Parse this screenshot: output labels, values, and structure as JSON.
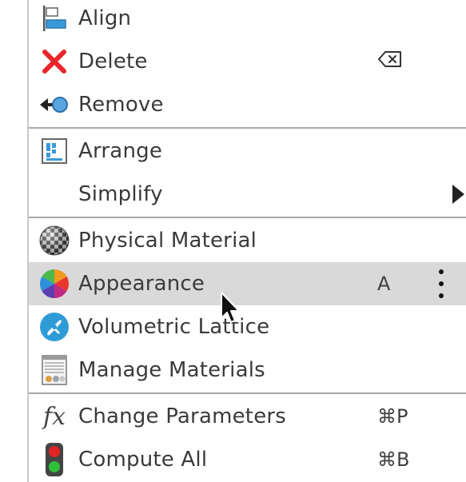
{
  "menu": {
    "items": [
      {
        "label": "Align",
        "icon": "align-icon"
      },
      {
        "label": "Delete",
        "icon": "delete-x-icon",
        "shortcut_icon": "delete-key-icon"
      },
      {
        "label": "Remove",
        "icon": "remove-icon"
      },
      {
        "label": "Arrange",
        "icon": "arrange-icon"
      },
      {
        "label": "Simplify",
        "submenu": true
      },
      {
        "label": "Physical Material",
        "icon": "physical-material-icon"
      },
      {
        "label": "Appearance",
        "icon": "appearance-icon",
        "shortcut": "A",
        "highlighted": true,
        "more": true
      },
      {
        "label": "Volumetric Lattice",
        "icon": "volumetric-lattice-icon"
      },
      {
        "label": "Manage Materials",
        "icon": "manage-materials-icon"
      },
      {
        "label": "Change Parameters",
        "icon": "fx-icon",
        "shortcut": "⌘P"
      },
      {
        "label": "Compute All",
        "icon": "traffic-light-icon",
        "shortcut": "⌘B"
      }
    ]
  },
  "colors": {
    "highlight": "#d9d9d9",
    "delete_red": "#e8262b",
    "accent_blue": "#2f9bd6",
    "separator": "#a8a8a8"
  }
}
